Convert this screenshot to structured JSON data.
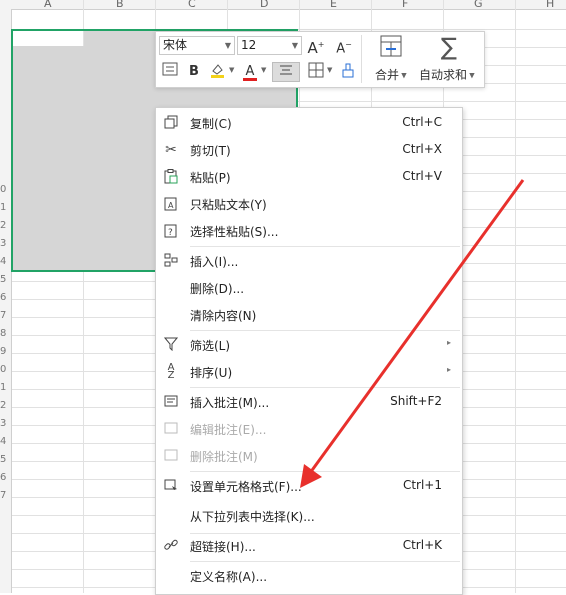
{
  "columns": [
    "A",
    "B",
    "C",
    "D",
    "E",
    "F",
    "G",
    "H"
  ],
  "rows": [
    "0",
    "1",
    "2",
    "3",
    "4",
    "5",
    "6",
    "7",
    "8",
    "9",
    "0",
    "1",
    "2",
    "3",
    "4",
    "5",
    "6",
    "7",
    "8",
    "9",
    "0",
    "1",
    "2",
    "3",
    "4",
    "5",
    "6",
    "7"
  ],
  "mini_toolbar": {
    "font_name": "宋体",
    "font_size": "12",
    "bold_label": "B",
    "font_color_label": "A",
    "merge_label": "合并",
    "autosum_label": "自动求和"
  },
  "context_menu": {
    "items": [
      {
        "label": "复制(C)",
        "shortcut": "Ctrl+C",
        "icon": "copy-icon"
      },
      {
        "label": "剪切(T)",
        "shortcut": "Ctrl+X",
        "icon": "scissors-icon"
      },
      {
        "label": "粘贴(P)",
        "shortcut": "Ctrl+V",
        "icon": "paste-icon"
      },
      {
        "label": "只粘贴文本(Y)",
        "shortcut": "",
        "icon": "paste-text-icon"
      },
      {
        "label": "选择性粘贴(S)...",
        "shortcut": "",
        "icon": "paste-special-icon"
      },
      {
        "label": "插入(I)...",
        "shortcut": "",
        "icon": "insert-icon"
      },
      {
        "label": "删除(D)...",
        "shortcut": "",
        "icon": ""
      },
      {
        "label": "清除内容(N)",
        "shortcut": "",
        "icon": ""
      },
      {
        "label": "筛选(L)",
        "shortcut": "",
        "icon": "filter-icon"
      },
      {
        "label": "排序(U)",
        "shortcut": "",
        "icon": "sort-icon"
      },
      {
        "label": "插入批注(M)...",
        "shortcut": "Shift+F2",
        "icon": "comment-add-icon"
      },
      {
        "label": "编辑批注(E)...",
        "shortcut": "",
        "icon": "comment-edit-icon"
      },
      {
        "label": "删除批注(M)",
        "shortcut": "",
        "icon": "comment-delete-icon"
      },
      {
        "label": "设置单元格格式(F)...",
        "shortcut": "Ctrl+1",
        "icon": "format-cells-icon"
      },
      {
        "label": "从下拉列表中选择(K)...",
        "shortcut": "",
        "icon": ""
      },
      {
        "label": "超链接(H)...",
        "shortcut": "Ctrl+K",
        "icon": "link-icon"
      },
      {
        "label": "定义名称(A)...",
        "shortcut": "",
        "icon": ""
      }
    ]
  },
  "annotation_color": "#e8302c",
  "selection_color": "#21a366"
}
